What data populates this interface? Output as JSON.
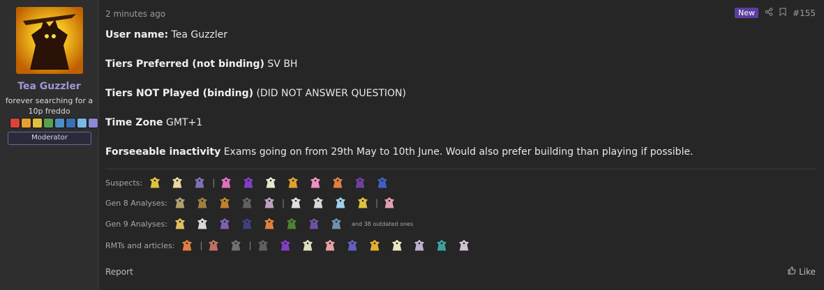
{
  "user": {
    "name": "Tea Guzzler",
    "title": "forever searching for a 10p freddo",
    "role": "Moderator",
    "badge_colors": [
      "#d9433a",
      "#e8a030",
      "#e0c040",
      "#5aa050",
      "#4a90c0",
      "#3b6fb0",
      "#7ab8e8",
      "#8a8ad8"
    ]
  },
  "post": {
    "time": "2 minutes ago",
    "new_label": "New",
    "number": "#155",
    "lines": [
      {
        "label": "User name:",
        "value": "Tea Guzzler"
      },
      {
        "label": "Tiers Preferred (not binding)",
        "value": "SV BH"
      },
      {
        "label": "Tiers NOT Played (binding)",
        "value": "(DID NOT ANSWER QUESTION)"
      },
      {
        "label": "Time Zone",
        "value": "GMT+1"
      },
      {
        "label": "Forseeable inactivity",
        "value": "Exams going on from 29th May to 10th June. Would also prefer building than playing if possible."
      }
    ]
  },
  "signature": {
    "suspects_label": "Suspects:",
    "gen8_label": "Gen 8 Analyses:",
    "gen9_label": "Gen 9 Analyses:",
    "gen9_note": "and 38 outdated ones",
    "rmts_label": "RMTs and articles:",
    "separator": "|"
  },
  "footer": {
    "report": "Report",
    "like": "Like"
  },
  "colors": {
    "accent": "#5a3fa0",
    "username": "#9d98d6"
  }
}
